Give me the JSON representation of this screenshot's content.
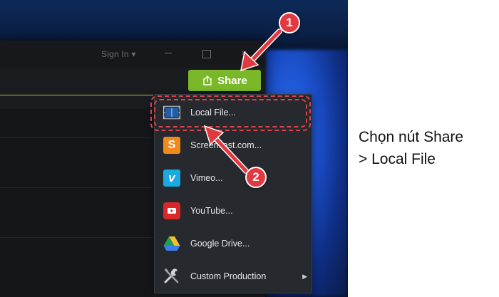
{
  "window": {
    "sign_in_label": "Sign In",
    "sign_in_caret": "▾",
    "close_glyph": "×"
  },
  "toolbar": {
    "share_label": "Share"
  },
  "share_menu": {
    "items": [
      {
        "label": "Local File...",
        "icon": "film-icon"
      },
      {
        "label": "Screencast.com...",
        "icon": "screencast-icon",
        "icon_letter": "S"
      },
      {
        "label": "Vimeo...",
        "icon": "vimeo-icon",
        "icon_letter": "v"
      },
      {
        "label": "YouTube...",
        "icon": "youtube-icon"
      },
      {
        "label": "Google Drive...",
        "icon": "google-drive-icon"
      },
      {
        "label": "Custom Production",
        "icon": "tools-icon",
        "has_submenu": true
      }
    ],
    "submenu_arrow": "▶"
  },
  "annotations": {
    "step_1": "1",
    "step_2": "2"
  },
  "caption": {
    "line_1": "Chọn nút Share",
    "line_2": "> Local File"
  },
  "colors": {
    "share_green": "#7ab829",
    "annotation_red": "#e2383f",
    "menu_bg": "#26292e"
  }
}
